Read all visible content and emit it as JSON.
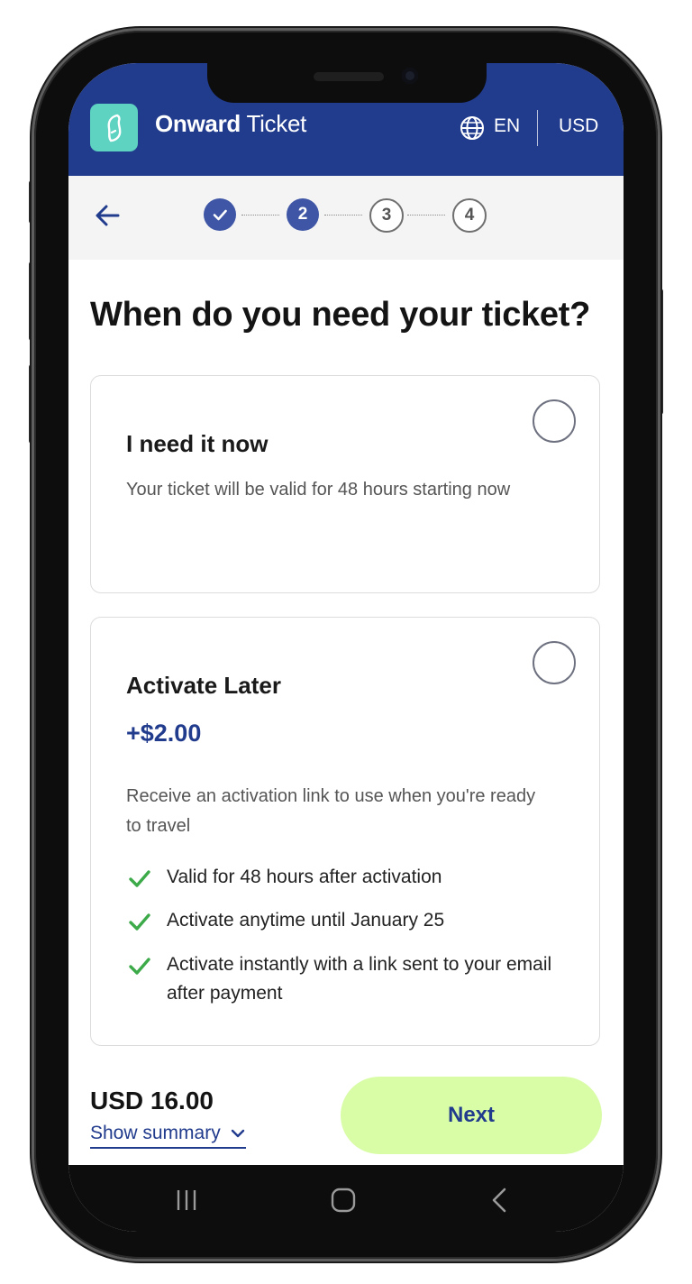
{
  "header": {
    "brand_bold": "Onward",
    "brand_regular": " Ticket",
    "language": "EN",
    "currency": "USD",
    "bg_color": "#213b8d",
    "logo_color": "#5fd3c1"
  },
  "stepper": {
    "steps": [
      {
        "label": "",
        "state": "done"
      },
      {
        "label": "2",
        "state": "active"
      },
      {
        "label": "3",
        "state": "todo"
      },
      {
        "label": "4",
        "state": "todo"
      }
    ]
  },
  "page": {
    "title": "When do you need your ticket?"
  },
  "options": [
    {
      "title": "I need it now",
      "description": "Your ticket will be valid for 48 hours starting now",
      "selected": false
    },
    {
      "title": "Activate Later",
      "price": "+$2.00",
      "description": "Receive an activation link to use when you're ready to travel",
      "features": [
        "Valid for 48 hours after activation",
        "Activate anytime until January 25",
        "Activate instantly with a link sent to your email after payment"
      ],
      "selected": false
    }
  ],
  "footer": {
    "total": "USD 16.00",
    "summary_link": "Show summary",
    "next_label": "Next",
    "next_color": "#d9fca7"
  },
  "icons": {
    "logo": "phone-leaf-logo-icon",
    "globe": "globe-icon",
    "back": "arrow-left-icon",
    "check": "checkmark-icon",
    "chevron": "chevron-down-icon"
  }
}
